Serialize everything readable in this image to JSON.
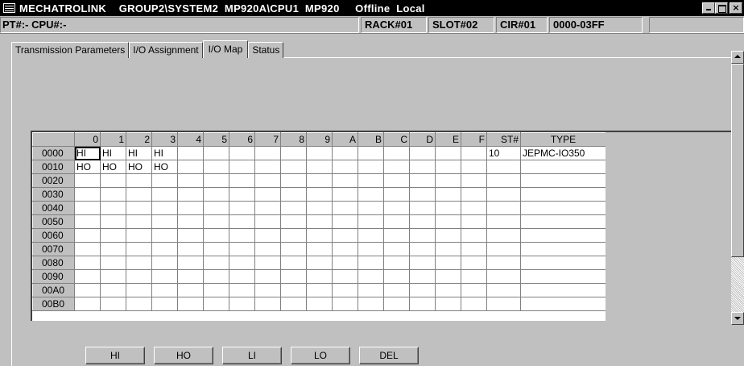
{
  "window": {
    "title": "MECHATROLINK    GROUP2\\SYSTEM2  MP920A\\CPU1  MP920     Offline  Local",
    "controls": {
      "minimize": "_",
      "maximize": "□",
      "close": "×"
    }
  },
  "statusbar": {
    "pt_cpu": "PT#:- CPU#:-",
    "rack": "RACK#01",
    "slot": "SLOT#02",
    "cir": "CIR#01",
    "range": "0000-03FF",
    "extra": ""
  },
  "tabs": [
    {
      "label": "Transmission Parameters",
      "active": false
    },
    {
      "label": "I/O Assignment",
      "active": false
    },
    {
      "label": "I/O Map",
      "active": true
    },
    {
      "label": "Status",
      "active": false
    }
  ],
  "grid": {
    "columns": [
      "0",
      "1",
      "2",
      "3",
      "4",
      "5",
      "6",
      "7",
      "8",
      "9",
      "A",
      "B",
      "C",
      "D",
      "E",
      "F",
      "ST#",
      "TYPE"
    ],
    "rows": [
      {
        "addr": "0000",
        "cells": [
          "HI",
          "HI",
          "HI",
          "HI",
          "",
          "",
          "",
          "",
          "",
          "",
          "",
          "",
          "",
          "",
          "",
          "",
          "10",
          "JEPMC-IO350"
        ]
      },
      {
        "addr": "0010",
        "cells": [
          "HO",
          "HO",
          "HO",
          "HO",
          "",
          "",
          "",
          "",
          "",
          "",
          "",
          "",
          "",
          "",
          "",
          "",
          "",
          ""
        ]
      },
      {
        "addr": "0020",
        "cells": [
          "",
          "",
          "",
          "",
          "",
          "",
          "",
          "",
          "",
          "",
          "",
          "",
          "",
          "",
          "",
          "",
          "",
          ""
        ]
      },
      {
        "addr": "0030",
        "cells": [
          "",
          "",
          "",
          "",
          "",
          "",
          "",
          "",
          "",
          "",
          "",
          "",
          "",
          "",
          "",
          "",
          "",
          ""
        ]
      },
      {
        "addr": "0040",
        "cells": [
          "",
          "",
          "",
          "",
          "",
          "",
          "",
          "",
          "",
          "",
          "",
          "",
          "",
          "",
          "",
          "",
          "",
          ""
        ]
      },
      {
        "addr": "0050",
        "cells": [
          "",
          "",
          "",
          "",
          "",
          "",
          "",
          "",
          "",
          "",
          "",
          "",
          "",
          "",
          "",
          "",
          "",
          ""
        ]
      },
      {
        "addr": "0060",
        "cells": [
          "",
          "",
          "",
          "",
          "",
          "",
          "",
          "",
          "",
          "",
          "",
          "",
          "",
          "",
          "",
          "",
          "",
          ""
        ]
      },
      {
        "addr": "0070",
        "cells": [
          "",
          "",
          "",
          "",
          "",
          "",
          "",
          "",
          "",
          "",
          "",
          "",
          "",
          "",
          "",
          "",
          "",
          ""
        ]
      },
      {
        "addr": "0080",
        "cells": [
          "",
          "",
          "",
          "",
          "",
          "",
          "",
          "",
          "",
          "",
          "",
          "",
          "",
          "",
          "",
          "",
          "",
          ""
        ]
      },
      {
        "addr": "0090",
        "cells": [
          "",
          "",
          "",
          "",
          "",
          "",
          "",
          "",
          "",
          "",
          "",
          "",
          "",
          "",
          "",
          "",
          "",
          ""
        ]
      },
      {
        "addr": "00A0",
        "cells": [
          "",
          "",
          "",
          "",
          "",
          "",
          "",
          "",
          "",
          "",
          "",
          "",
          "",
          "",
          "",
          "",
          "",
          ""
        ]
      },
      {
        "addr": "00B0",
        "cells": [
          "",
          "",
          "",
          "",
          "",
          "",
          "",
          "",
          "",
          "",
          "",
          "",
          "",
          "",
          "",
          "",
          "",
          ""
        ]
      }
    ],
    "selected_cell": {
      "row": 0,
      "col": 0
    }
  },
  "buttons": [
    {
      "label": "HI",
      "name": "hi-button"
    },
    {
      "label": "HO",
      "name": "ho-button"
    },
    {
      "label": "LI",
      "name": "li-button"
    },
    {
      "label": "LO",
      "name": "lo-button"
    },
    {
      "label": "DEL",
      "name": "del-button"
    }
  ],
  "scrollbar": {
    "up_icon": "arrow-up-icon",
    "down_icon": "arrow-down-icon"
  }
}
